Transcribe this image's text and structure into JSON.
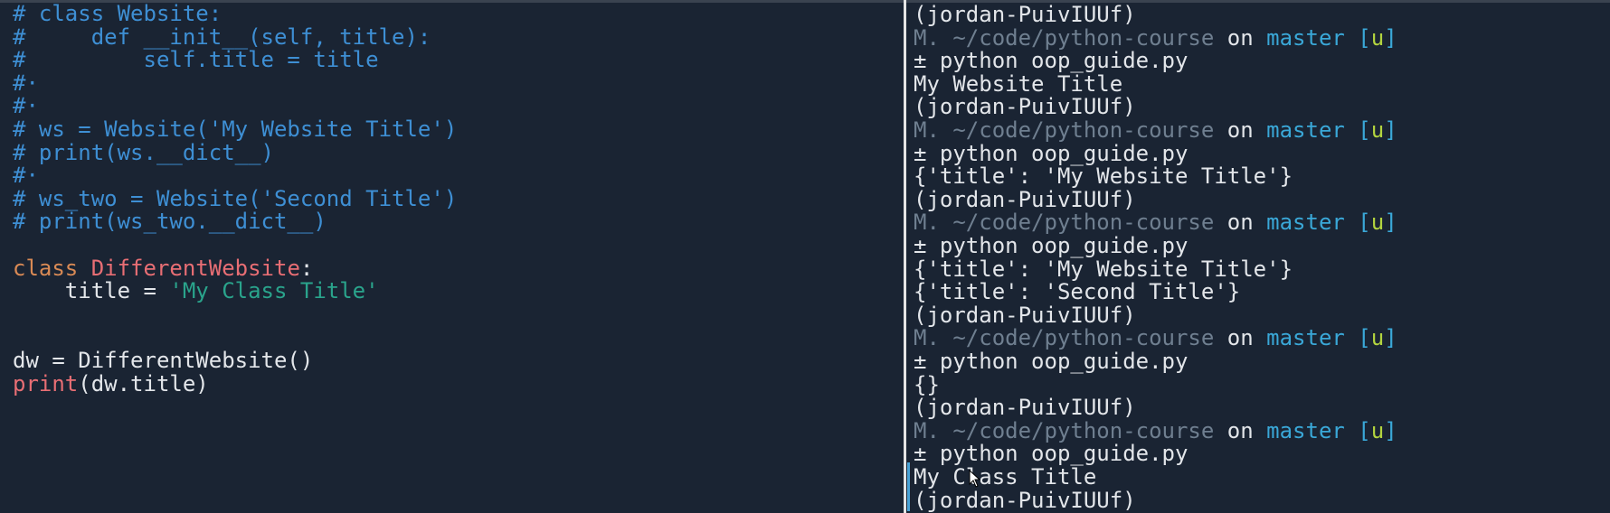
{
  "colors": {
    "background": "#1a2433",
    "comment": "#3e8fd4",
    "keyword": "#d98a55",
    "class_name": "#e86e74",
    "string": "#2aa48c",
    "builtin": "#e86e74",
    "text": "#e3e6ea",
    "prompt_path": "#6f7f90",
    "prompt_branch": "#3aa8d8",
    "prompt_status": "#b3d43f"
  },
  "editor": {
    "lines": [
      [
        {
          "t": "# class Website:",
          "c": "comment"
        }
      ],
      [
        {
          "t": "#     def __init__(self, title):",
          "c": "comment"
        }
      ],
      [
        {
          "t": "#         self.title = title",
          "c": "comment"
        }
      ],
      [
        {
          "t": "#·",
          "c": "comment"
        }
      ],
      [
        {
          "t": "#·",
          "c": "comment"
        }
      ],
      [
        {
          "t": "# ws = Website('My Website Title')",
          "c": "comment"
        }
      ],
      [
        {
          "t": "# print(ws.__dict__)",
          "c": "comment"
        }
      ],
      [
        {
          "t": "#·",
          "c": "comment"
        }
      ],
      [
        {
          "t": "# ws_two = Website('Second Title')",
          "c": "comment"
        }
      ],
      [
        {
          "t": "# print(ws_two.__dict__)",
          "c": "comment"
        }
      ],
      [
        {
          "t": "",
          "c": "text"
        }
      ],
      [
        {
          "t": "class ",
          "c": "keyword"
        },
        {
          "t": "DifferentWebsite",
          "c": "class_name"
        },
        {
          "t": ":",
          "c": "text"
        }
      ],
      [
        {
          "t": "    title = ",
          "c": "text"
        },
        {
          "t": "'My Class Title'",
          "c": "string"
        }
      ],
      [
        {
          "t": "",
          "c": "text"
        }
      ],
      [
        {
          "t": "",
          "c": "text"
        }
      ],
      [
        {
          "t": "dw = DifferentWebsite()",
          "c": "text"
        }
      ],
      [
        {
          "t": "print",
          "c": "builtin"
        },
        {
          "t": "(dw.title)",
          "c": "text"
        }
      ]
    ]
  },
  "terminal": {
    "lines": [
      [
        {
          "t": "(jordan-PuivIUUf)",
          "c": "text"
        }
      ],
      [
        {
          "t": "M. ~/code/python-course",
          "c": "prompt_path"
        },
        {
          "t": " on ",
          "c": "text"
        },
        {
          "t": "master",
          "c": "prompt_branch"
        },
        {
          "t": " [",
          "c": "prompt_branch"
        },
        {
          "t": "u",
          "c": "prompt_status"
        },
        {
          "t": "]",
          "c": "prompt_branch"
        }
      ],
      [
        {
          "t": "± python oop_guide.py",
          "c": "text"
        }
      ],
      [
        {
          "t": "My Website Title",
          "c": "text"
        }
      ],
      [
        {
          "t": "(jordan-PuivIUUf)",
          "c": "text"
        }
      ],
      [
        {
          "t": "M. ~/code/python-course",
          "c": "prompt_path"
        },
        {
          "t": " on ",
          "c": "text"
        },
        {
          "t": "master",
          "c": "prompt_branch"
        },
        {
          "t": " [",
          "c": "prompt_branch"
        },
        {
          "t": "u",
          "c": "prompt_status"
        },
        {
          "t": "]",
          "c": "prompt_branch"
        }
      ],
      [
        {
          "t": "± python oop_guide.py",
          "c": "text"
        }
      ],
      [
        {
          "t": "{'title': 'My Website Title'}",
          "c": "text"
        }
      ],
      [
        {
          "t": "(jordan-PuivIUUf)",
          "c": "text"
        }
      ],
      [
        {
          "t": "M. ~/code/python-course",
          "c": "prompt_path"
        },
        {
          "t": " on ",
          "c": "text"
        },
        {
          "t": "master",
          "c": "prompt_branch"
        },
        {
          "t": " [",
          "c": "prompt_branch"
        },
        {
          "t": "u",
          "c": "prompt_status"
        },
        {
          "t": "]",
          "c": "prompt_branch"
        }
      ],
      [
        {
          "t": "± python oop_guide.py",
          "c": "text"
        }
      ],
      [
        {
          "t": "{'title': 'My Website Title'}",
          "c": "text"
        }
      ],
      [
        {
          "t": "{'title': 'Second Title'}",
          "c": "text"
        }
      ],
      [
        {
          "t": "(jordan-PuivIUUf)",
          "c": "text"
        }
      ],
      [
        {
          "t": "M. ~/code/python-course",
          "c": "prompt_path"
        },
        {
          "t": " on ",
          "c": "text"
        },
        {
          "t": "master",
          "c": "prompt_branch"
        },
        {
          "t": " [",
          "c": "prompt_branch"
        },
        {
          "t": "u",
          "c": "prompt_status"
        },
        {
          "t": "]",
          "c": "prompt_branch"
        }
      ],
      [
        {
          "t": "± python oop_guide.py",
          "c": "text"
        }
      ],
      [
        {
          "t": "{}",
          "c": "text"
        }
      ],
      [
        {
          "t": "(jordan-PuivIUUf)",
          "c": "text"
        }
      ],
      [
        {
          "t": "M. ~/code/python-course",
          "c": "prompt_path"
        },
        {
          "t": " on ",
          "c": "text"
        },
        {
          "t": "master",
          "c": "prompt_branch"
        },
        {
          "t": " [",
          "c": "prompt_branch"
        },
        {
          "t": "u",
          "c": "prompt_status"
        },
        {
          "t": "]",
          "c": "prompt_branch"
        }
      ],
      [
        {
          "t": "± python oop_guide.py",
          "c": "text"
        }
      ],
      [
        {
          "t": "My Class Title",
          "c": "text"
        }
      ],
      [
        {
          "t": "(jordan-PuivIUUf)",
          "c": "text"
        }
      ]
    ]
  },
  "icons": {
    "mouse_cursor": "mouse-pointer-icon"
  }
}
